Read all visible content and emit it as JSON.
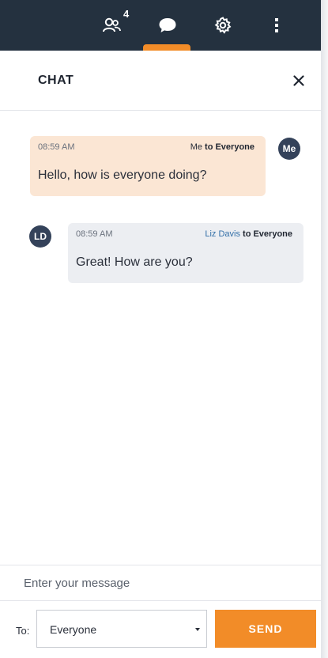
{
  "topbar": {
    "participants_icon": "participants-icon",
    "participants_count": "4",
    "chat_icon": "chat-bubble-icon",
    "settings_icon": "gear-icon",
    "more_icon": "kebab-menu-icon",
    "active_tab": "chat",
    "bg_color": "#24313f",
    "accent_color": "#f28c28"
  },
  "header": {
    "title": "CHAT",
    "close_icon": "close-icon"
  },
  "messages": [
    {
      "time": "08:59 AM",
      "sender": "Me",
      "recipient": "to Everyone",
      "text": "Hello, how is everyone doing?",
      "avatar": "Me",
      "bubble_color": "#fbe6d4"
    },
    {
      "time": "08:59 AM",
      "sender": "Liz Davis",
      "recipient": "to Everyone",
      "text": "Great! How are you?",
      "avatar": "LD",
      "bubble_color": "#eceef2"
    }
  ],
  "composer": {
    "placeholder": "Enter your message",
    "value": ""
  },
  "footer": {
    "to_label": "To:",
    "to_value": "Everyone",
    "send_label": "SEND"
  }
}
